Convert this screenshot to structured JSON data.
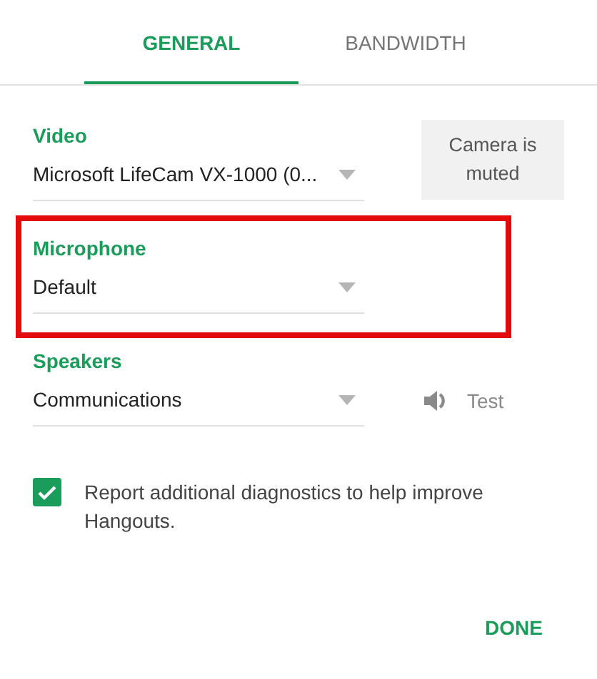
{
  "tabs": [
    {
      "label": "GENERAL",
      "selected": true
    },
    {
      "label": "BANDWIDTH",
      "selected": false
    }
  ],
  "devices": [
    {
      "label": "Video",
      "value": "Microsoft LifeCam VX-1000 (0...",
      "highlighted": false,
      "side": {
        "kind": "notice",
        "text": "Camera is muted"
      }
    },
    {
      "label": "Microphone",
      "value": "Default",
      "highlighted": true
    },
    {
      "label": "Speakers",
      "value": "Communications",
      "highlighted": false,
      "side": {
        "kind": "test",
        "text": "Test"
      }
    }
  ],
  "diagnostics": {
    "checked": true,
    "text": "Report additional diagnostics to help improve Hangouts."
  },
  "done_button": "DONE"
}
